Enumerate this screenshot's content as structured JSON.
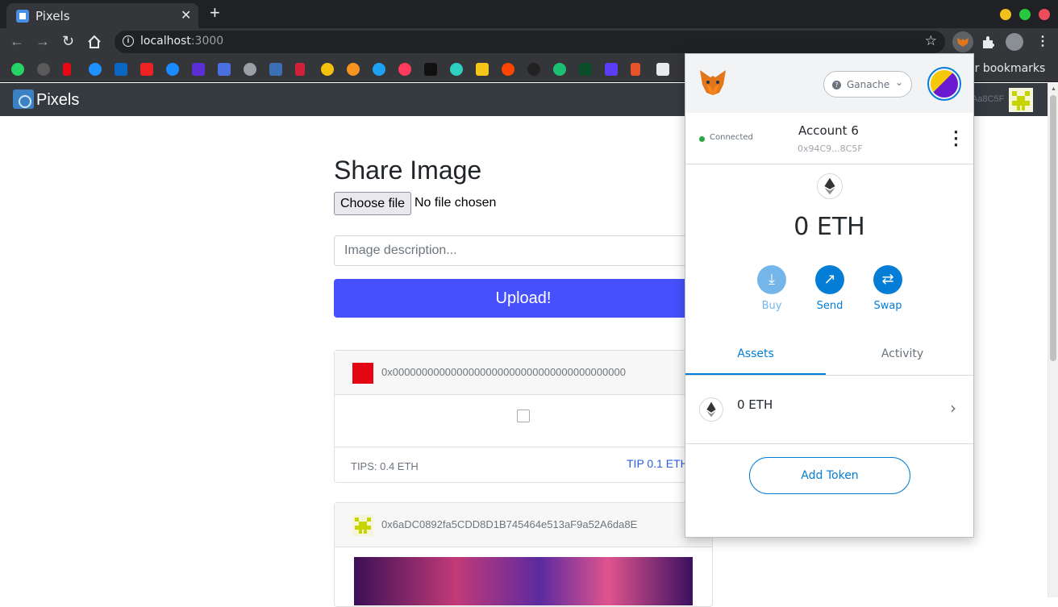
{
  "browser": {
    "tab_title": "Pixels",
    "close_glyph": "✕",
    "new_tab_glyph": "+",
    "url_host": "localhost",
    "url_port": ":3000",
    "other_bookmarks": "er bookmarks",
    "window_controls": {
      "minimize": "#f2c01c",
      "maximize": "#27c93f",
      "close": "#ed4c5c"
    }
  },
  "app": {
    "brand": "Pixels",
    "nav_account": "Aa8C5F"
  },
  "share": {
    "title": "Share Image",
    "choose_file": "Choose file",
    "no_file": "No file chosen",
    "description_placeholder": "Image description...",
    "upload_label": "Upload!"
  },
  "posts": [
    {
      "author": "0x0000000000000000000000000000000000000000",
      "tips": "TIPS: 0.4 ETH",
      "tip_action": "TIP 0.1 ETH"
    },
    {
      "author": "0x6aDC0892fa5CDD8D1B745464e513aF9a52A6da8E"
    }
  ],
  "metamask": {
    "network": "Ganache",
    "status": "Connected",
    "account_name": "Account 6",
    "account_address": "0x94C9...8C5F",
    "balance": "0 ETH",
    "actions": {
      "buy": "Buy",
      "send": "Send",
      "swap": "Swap"
    },
    "tabs": {
      "assets": "Assets",
      "activity": "Activity"
    },
    "asset_amount": "0 ETH",
    "add_token": "Add Token",
    "accent_color": "#037dd6"
  }
}
